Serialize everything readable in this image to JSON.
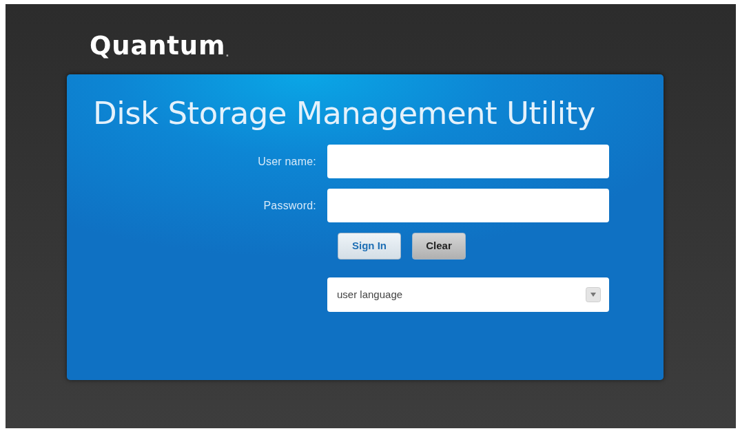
{
  "logo": {
    "name": "Quantum",
    "mark": "."
  },
  "panel": {
    "title": "Disk Storage Management Utility",
    "fields": [
      {
        "label": "User name:"
      },
      {
        "label": "Password:"
      }
    ],
    "buttons": [
      {
        "label": "Sign In",
        "kind": "primary"
      },
      {
        "label": "Clear",
        "kind": "secondary"
      }
    ],
    "language_select": {
      "value": "user language"
    }
  }
}
